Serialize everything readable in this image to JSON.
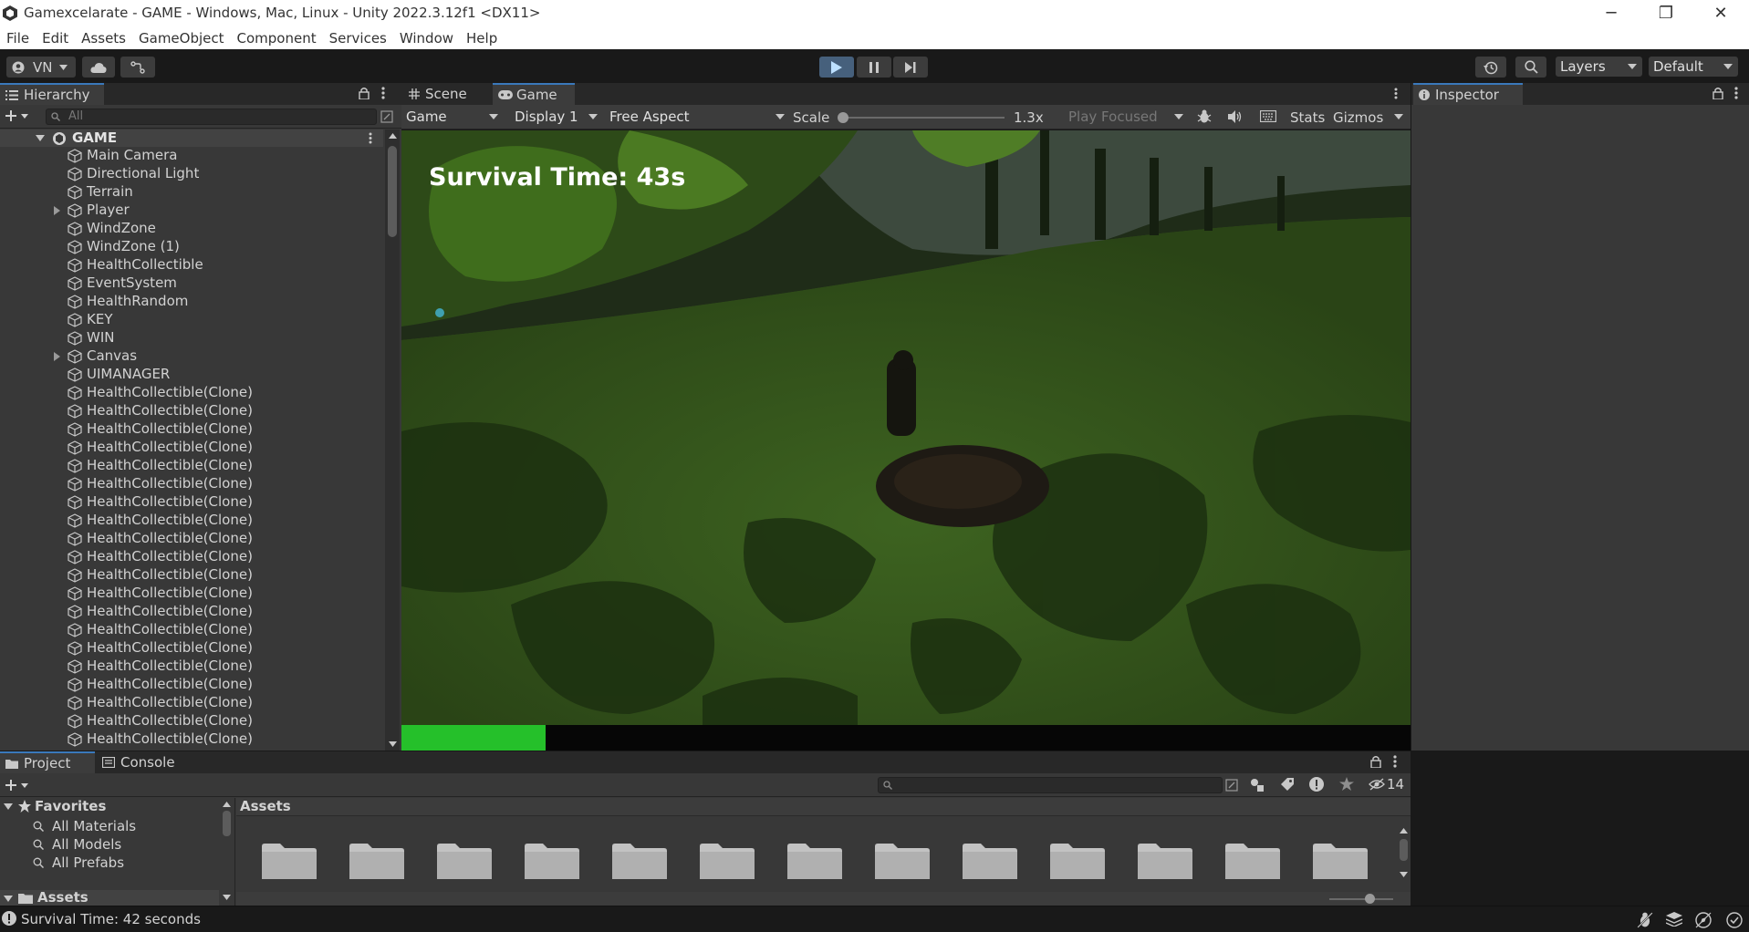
{
  "window": {
    "title": "Gamexcelarate - GAME - Windows, Mac, Linux - Unity 2022.3.12f1 <DX11>",
    "minimize": "─",
    "restore": "❐",
    "close": "✕"
  },
  "menu": [
    "File",
    "Edit",
    "Assets",
    "GameObject",
    "Component",
    "Services",
    "Window",
    "Help"
  ],
  "toolbar": {
    "account": "VN",
    "layers": "Layers",
    "layout": "Default"
  },
  "hierarchy": {
    "tab": "Hierarchy",
    "search_placeholder": "All",
    "scene": "GAME",
    "items": [
      {
        "name": "Main Camera",
        "expandable": false
      },
      {
        "name": "Directional Light",
        "expandable": false
      },
      {
        "name": "Terrain",
        "expandable": false
      },
      {
        "name": "Player",
        "expandable": true
      },
      {
        "name": "WindZone",
        "expandable": false
      },
      {
        "name": "WindZone (1)",
        "expandable": false
      },
      {
        "name": "HealthCollectible",
        "expandable": false
      },
      {
        "name": "EventSystem",
        "expandable": false
      },
      {
        "name": "HealthRandom",
        "expandable": false
      },
      {
        "name": "KEY",
        "expandable": false
      },
      {
        "name": "WIN",
        "expandable": false
      },
      {
        "name": "Canvas",
        "expandable": true
      },
      {
        "name": "UIMANAGER",
        "expandable": false
      },
      {
        "name": "HealthCollectible(Clone)",
        "expandable": false
      },
      {
        "name": "HealthCollectible(Clone)",
        "expandable": false
      },
      {
        "name": "HealthCollectible(Clone)",
        "expandable": false
      },
      {
        "name": "HealthCollectible(Clone)",
        "expandable": false
      },
      {
        "name": "HealthCollectible(Clone)",
        "expandable": false
      },
      {
        "name": "HealthCollectible(Clone)",
        "expandable": false
      },
      {
        "name": "HealthCollectible(Clone)",
        "expandable": false
      },
      {
        "name": "HealthCollectible(Clone)",
        "expandable": false
      },
      {
        "name": "HealthCollectible(Clone)",
        "expandable": false
      },
      {
        "name": "HealthCollectible(Clone)",
        "expandable": false
      },
      {
        "name": "HealthCollectible(Clone)",
        "expandable": false
      },
      {
        "name": "HealthCollectible(Clone)",
        "expandable": false
      },
      {
        "name": "HealthCollectible(Clone)",
        "expandable": false
      },
      {
        "name": "HealthCollectible(Clone)",
        "expandable": false
      },
      {
        "name": "HealthCollectible(Clone)",
        "expandable": false
      },
      {
        "name": "HealthCollectible(Clone)",
        "expandable": false
      },
      {
        "name": "HealthCollectible(Clone)",
        "expandable": false
      },
      {
        "name": "HealthCollectible(Clone)",
        "expandable": false
      },
      {
        "name": "HealthCollectible(Clone)",
        "expandable": false
      },
      {
        "name": "HealthCollectible(Clone)",
        "expandable": false
      },
      {
        "name": "HealthCollectible(Clone)",
        "expandable": false
      },
      {
        "name": "HealthCollectible(Clone)",
        "expandable": false
      },
      {
        "name": "HealthCollectible(Clone)",
        "expandable": false
      }
    ]
  },
  "game_view": {
    "tabs": [
      "Scene",
      "Game"
    ],
    "mode": "Game",
    "display": "Display 1",
    "aspect": "Free Aspect",
    "scale_label": "Scale",
    "scale_value": "1.3x",
    "play_focused": "Play Focused",
    "stats": "Stats",
    "gizmos": "Gizmos",
    "hud_text": "Survival Time: 43s",
    "health_fraction": 0.143,
    "health_color": "#25c02a"
  },
  "inspector": {
    "tab": "Inspector"
  },
  "project": {
    "tabs": [
      "Project",
      "Console"
    ],
    "favorites_label": "Favorites",
    "favorites": [
      "All Materials",
      "All Models",
      "All Prefabs"
    ],
    "assets_label": "Assets",
    "breadcrumb": "Assets",
    "hidden_count": "14",
    "folder_count": 13
  },
  "status": {
    "message": "Survival Time: 42 seconds"
  },
  "colors": {
    "accent": "#3a79bb",
    "play_active": "#46607c",
    "panel_bg": "#282828",
    "editor_bg": "#191919"
  }
}
